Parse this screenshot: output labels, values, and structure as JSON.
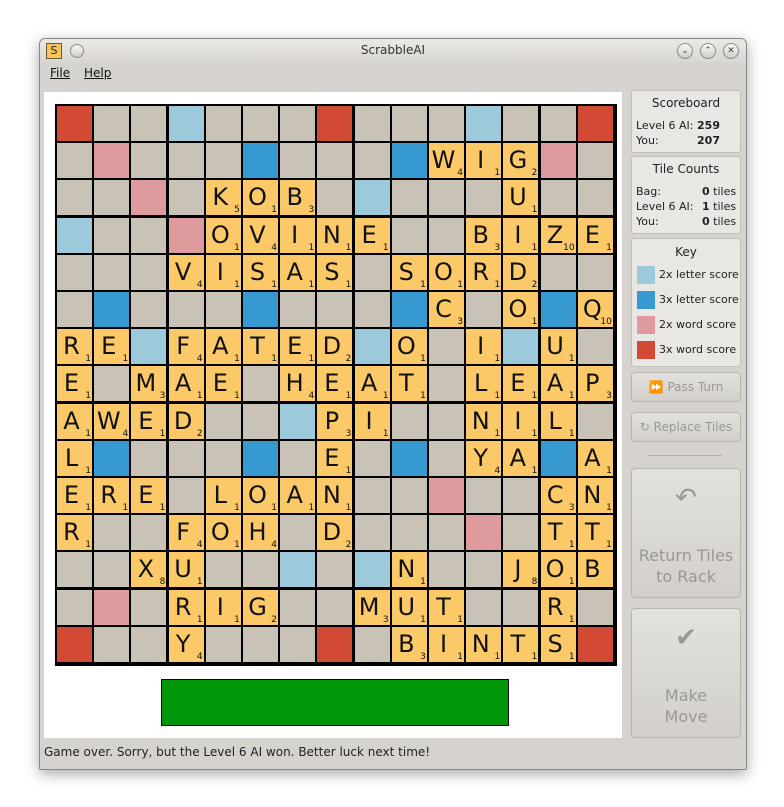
{
  "window": {
    "title": "ScrabbleAI",
    "icon_letter": "S"
  },
  "menu": {
    "file": "File",
    "help": "Help"
  },
  "status": "Game over. Sorry, but the Level 6 AI won. Better luck next time!",
  "scoreboard": {
    "title": "Scoreboard",
    "ai_label": "Level 6 AI:",
    "ai_score": "259",
    "you_label": "You:",
    "you_score": "207"
  },
  "tile_counts": {
    "title": "Tile Counts",
    "bag_label": "Bag:",
    "bag_count": "0",
    "bag_unit": "tiles",
    "ai_label": "Level 6 AI:",
    "ai_count": "1",
    "ai_unit": "tiles",
    "you_label": "You:",
    "you_count": "0",
    "you_unit": "tiles"
  },
  "key": {
    "title": "Key",
    "items": [
      {
        "label": "2x letter score",
        "color": "#9ccadb"
      },
      {
        "label": "3x letter score",
        "color": "#369ad0"
      },
      {
        "label": "2x word score",
        "color": "#de9a9c"
      },
      {
        "label": "3x word score",
        "color": "#d24a34"
      }
    ]
  },
  "buttons": {
    "pass_turn": "Pass Turn",
    "replace_tiles": "Replace Tiles",
    "return_line1": "Return Tiles",
    "return_line2": "to Rack",
    "make_line1": "Make",
    "make_line2": "Move"
  },
  "colors": {
    "empty": "#c9c2b7",
    "tile": "#fbc968",
    "rack": "#00960a",
    "dl": "#9ccadb",
    "tl": "#369ad0",
    "dw": "#de9a9c",
    "tw": "#d24a34"
  },
  "board": {
    "premium_rows": [
      "T..d...T...d..T",
      ".D...t...t...D.",
      "..D...d.d...D..",
      "d..D...d...D..d",
      "....D.....D....",
      ".t...t...t...t.",
      "..d...d.d...d..",
      "T..d...D...d..T",
      "..d...d.d...d..",
      ".t...t...t...t.",
      "....D.....D....",
      "d..D...d...D..d",
      "..D...d.d...D..",
      ".D...t...t...D.",
      "T..d...T...d..T"
    ],
    "tile_rows": [
      "...............",
      "..........WIG..",
      "....KOB.....U..",
      "....OVINE..BIZE",
      "...VISAS.SORD..",
      "..........C.O.Q",
      "RE.FATED.O.I.U.",
      "E.MAE.HEAT.LEAP",
      "AWED...PI..NIL.",
      "L......E...YA.A",
      "ERE.LOAN.....CN",
      "R..FOH.D.....TT",
      "..XU.....N..JOB",
      "...RIG..MUT..R.",
      "...Y.....BINTS."
    ],
    "blank_tiles": [
      [
        12,
        14
      ]
    ],
    "letter_values": {
      "A": 1,
      "B": 3,
      "C": 3,
      "D": 2,
      "E": 1,
      "F": 4,
      "G": 2,
      "H": 4,
      "I": 1,
      "J": 8,
      "K": 5,
      "L": 1,
      "M": 3,
      "N": 1,
      "O": 1,
      "P": 3,
      "Q": 10,
      "R": 1,
      "S": 1,
      "T": 1,
      "U": 1,
      "V": 4,
      "W": 4,
      "X": 8,
      "Y": 4,
      "Z": 10
    }
  }
}
